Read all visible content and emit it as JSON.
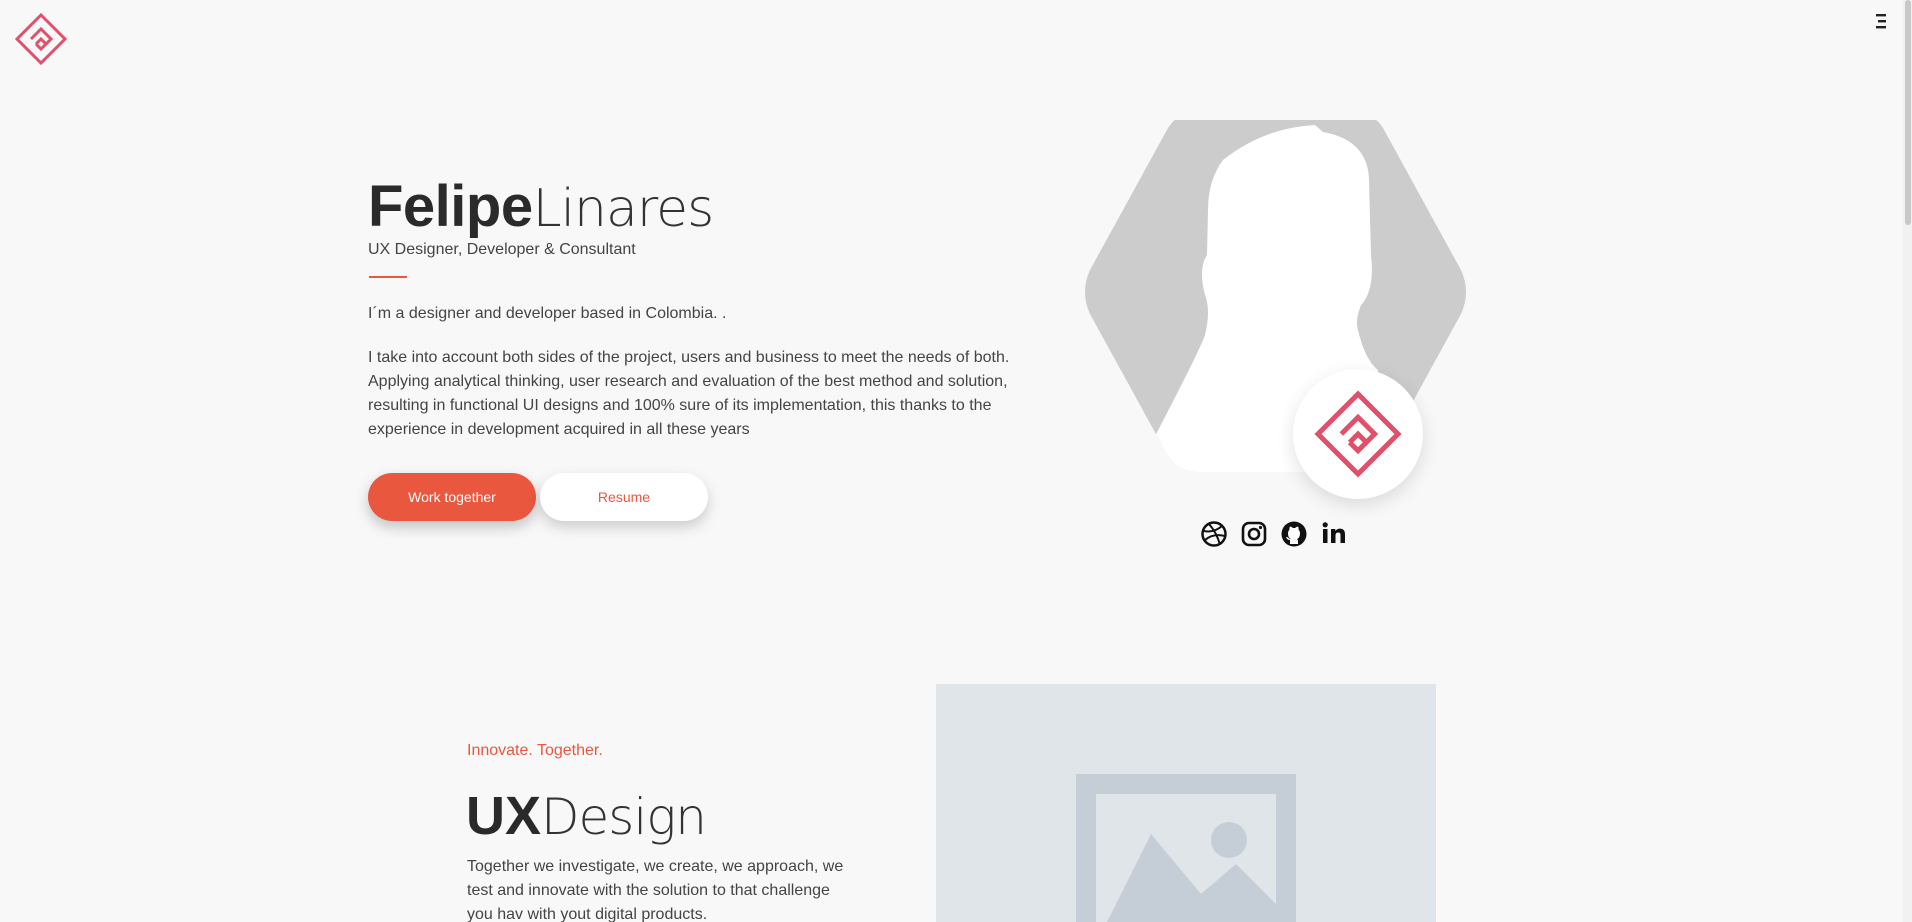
{
  "header": {
    "logo_icon": "fl-diamond-logo-icon",
    "menu_icon": "hamburger-menu-icon"
  },
  "hero": {
    "first_name": "Felipe",
    "last_name": "Linares",
    "role": "UX Designer, Developer & Consultant",
    "intro": "I´m a designer and developer based in Colombia. .",
    "body": "I take into account both sides of the project, users and business to meet the needs of both. Applying analytical thinking, user research and evaluation of the best method and solution, resulting in functional UI designs and 100% sure of its implementation, this thanks to the experience in development acquired in all these years",
    "primary_button": "Work together",
    "secondary_button": "Resume"
  },
  "socials": [
    {
      "name": "dribbble",
      "icon": "dribbble-icon"
    },
    {
      "name": "instagram",
      "icon": "instagram-icon"
    },
    {
      "name": "github",
      "icon": "github-icon"
    },
    {
      "name": "linkedin",
      "icon": "linkedin-icon"
    }
  ],
  "section": {
    "tagline": "Innovate. Together.",
    "title_bold": "UX",
    "title_light": "Design",
    "body": "Together we investigate, we create, we approach, we test and innovate with the solution to that challenge you hav with yout digital products."
  },
  "colors": {
    "accent": "#e9573f",
    "logo_pink": "#e0506a",
    "background": "#f8f8f8",
    "placeholder": "#e0e5e9",
    "text_dark": "#2a2a2a"
  }
}
